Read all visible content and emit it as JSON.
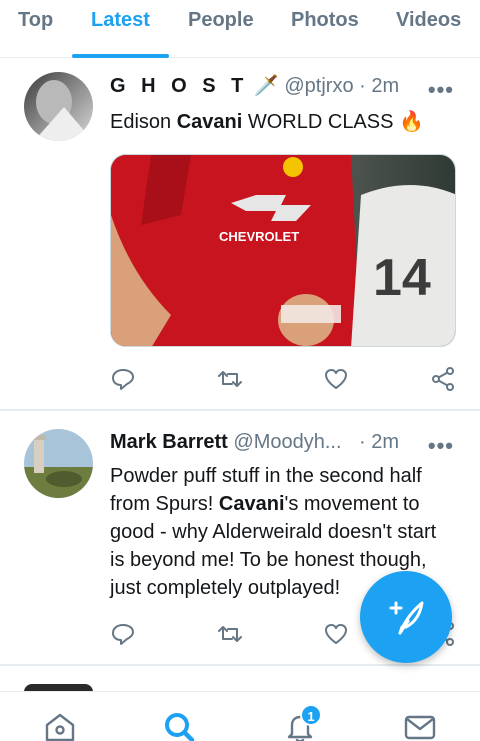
{
  "tabs": [
    {
      "label": "Top"
    },
    {
      "label": "Latest"
    },
    {
      "label": "People"
    },
    {
      "label": "Photos"
    },
    {
      "label": "Videos"
    }
  ],
  "tweets": [
    {
      "name": "G H O S T",
      "name_emoji": "🗡️",
      "handle": "@ptjrxo",
      "time": "· 2m",
      "text_pre": "Edison ",
      "text_bold": "Cavani",
      "text_post": " WORLD CLASS",
      "text_emoji": "🔥",
      "media_sponsor": "CHEVROLET",
      "media_number": "14"
    },
    {
      "name": "Mark Barrett",
      "handle": "@Moodyh...",
      "time": "· 2m",
      "text_line1": "Powder puff stuff in the second half",
      "text_line2_pre": "from Spurs! ",
      "text_line2_bold": "Cavani",
      "text_line2_post": "'s movement to",
      "text_line3": "good - why Alderweirald doesn't start",
      "text_line4": "is beyond me! To be honest though,",
      "text_line5": "just completely outplayed!"
    }
  ],
  "more_glyph": "•••",
  "nav": {
    "notifications_badge": "1"
  },
  "colors": {
    "accent": "#1da1f2",
    "muted": "#657786",
    "divider": "#e6ecf0"
  },
  "icons": [
    "reply-icon",
    "retweet-icon",
    "like-icon",
    "share-icon",
    "home-icon",
    "search-icon",
    "notifications-icon",
    "messages-icon",
    "compose-icon"
  ]
}
